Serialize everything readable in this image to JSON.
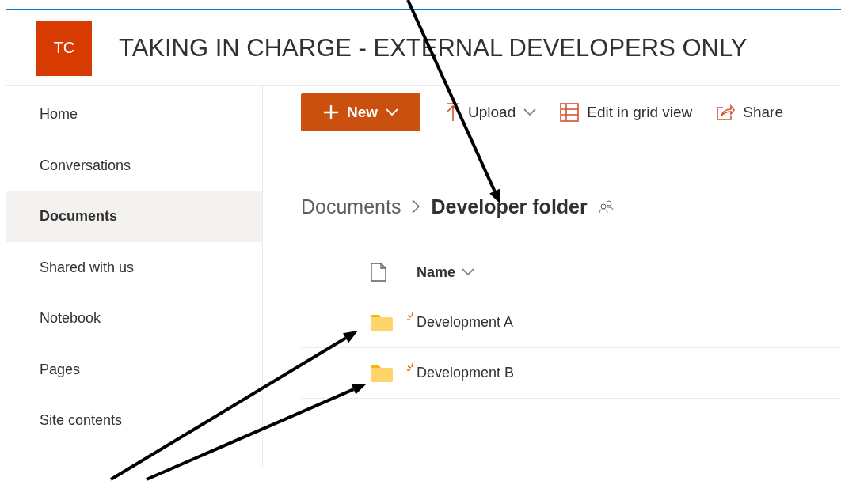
{
  "site": {
    "logo": "TC",
    "title": "TAKING IN CHARGE - EXTERNAL DEVELOPERS ONLY"
  },
  "nav": [
    {
      "label": "Home",
      "selected": false
    },
    {
      "label": "Conversations",
      "selected": false
    },
    {
      "label": "Documents",
      "selected": true
    },
    {
      "label": "Shared with us",
      "selected": false
    },
    {
      "label": "Notebook",
      "selected": false
    },
    {
      "label": "Pages",
      "selected": false
    },
    {
      "label": "Site contents",
      "selected": false
    }
  ],
  "commands": [
    {
      "kind": "new",
      "label": "New"
    },
    {
      "kind": "upload",
      "label": "Upload"
    },
    {
      "kind": "grid",
      "label": "Edit in grid view"
    },
    {
      "kind": "share",
      "label": "Share"
    }
  ],
  "breadcrumb": {
    "parent": "Documents",
    "current": "Developer folder"
  },
  "list": {
    "column": "Name",
    "rows": [
      {
        "name": "Development A",
        "is_new": true
      },
      {
        "name": "Development B",
        "is_new": true
      }
    ]
  },
  "annotations": [
    {
      "kind": "arrow"
    },
    {
      "kind": "arrow"
    },
    {
      "kind": "arrow"
    }
  ]
}
